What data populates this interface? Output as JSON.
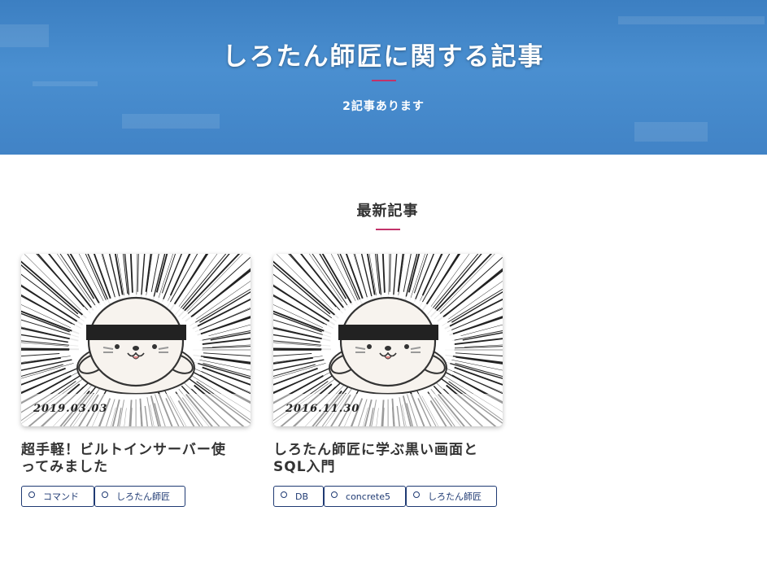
{
  "hero": {
    "title": "しろたん師匠に関する記事",
    "count": "2記事あります"
  },
  "section": {
    "title": "最新記事"
  },
  "posts": [
    {
      "date": "2019.03.03",
      "title_line1": "超手軽！ビルトインサーバー使",
      "title_line2": "ってみました",
      "tags": [
        "コマンド",
        "しろたん師匠"
      ]
    },
    {
      "date": "2016.11.30",
      "title_line1": "しろたん師匠に学ぶ黒い画面と",
      "title_line2": "SQL入門",
      "tags": [
        "DB",
        "concrete5",
        "しろたん師匠"
      ]
    }
  ],
  "colors": {
    "hero_blue": "#4a8fd0",
    "accent_rule": "#c2336a",
    "tag_border": "#1f3a73"
  },
  "icons": {
    "tag": "circle-icon"
  }
}
